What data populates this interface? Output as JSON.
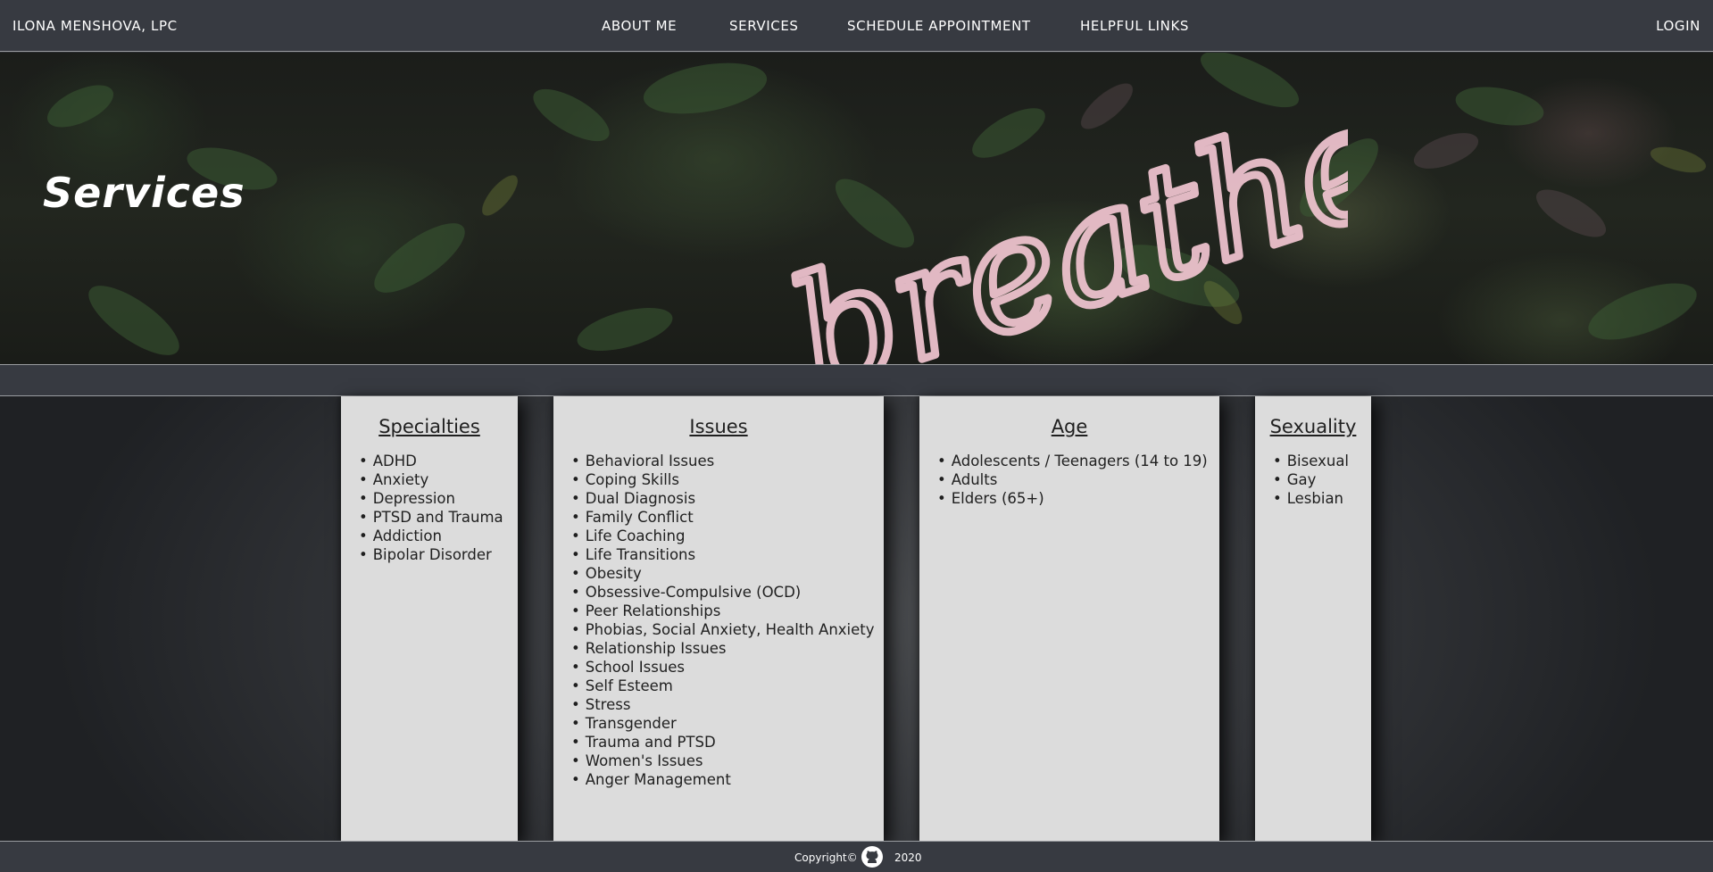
{
  "navbar": {
    "brand": "ILONA MENSHOVA, LPC",
    "links": [
      "ABOUT ME",
      "SERVICES",
      "SCHEDULE APPOINTMENT",
      "HELPFUL LINKS"
    ],
    "login": "LOGIN"
  },
  "hero": {
    "title": "Services",
    "neon_text": "breathe",
    "neon_color": "#f2c6d2"
  },
  "cards": [
    {
      "heading": "Specialties",
      "items": [
        "ADHD",
        "Anxiety",
        "Depression",
        "PTSD and Trauma",
        "Addiction",
        "Bipolar Disorder"
      ]
    },
    {
      "heading": "Issues",
      "items": [
        "Behavioral Issues",
        "Coping Skills",
        "Dual Diagnosis",
        "Family Conflict",
        "Life Coaching",
        "Life Transitions",
        "Obesity",
        "Obsessive-Compulsive (OCD)",
        "Peer Relationships",
        "Phobias, Social Anxiety, Health Anxiety",
        "Relationship Issues",
        "School Issues",
        "Self Esteem",
        "Stress",
        "Transgender",
        "Trauma and PTSD",
        "Women's Issues",
        "Anger Management"
      ]
    },
    {
      "heading": "Age",
      "items": [
        "Adolescents / Teenagers (14 to 19)",
        "Adults",
        "Elders (65+)"
      ]
    },
    {
      "heading": "Sexuality",
      "items": [
        "Bisexual",
        "Gay",
        "Lesbian"
      ]
    }
  ],
  "footer": {
    "copyright": "Copyright©",
    "icon": "github-icon",
    "year": "2020"
  },
  "colors": {
    "nav_bg": "#373a41",
    "card_bg": "#dcdcdc",
    "text_dark": "#1f1f1f"
  }
}
